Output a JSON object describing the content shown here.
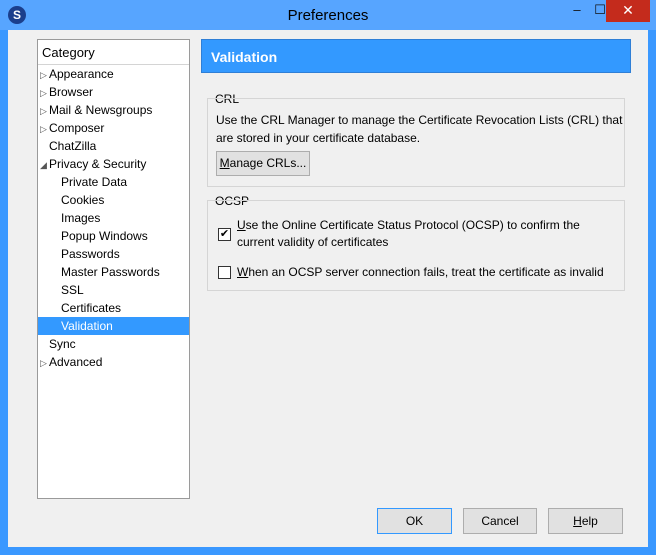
{
  "window": {
    "title": "Preferences",
    "icon": "app-logo-icon",
    "controls": {
      "minimize": "–",
      "maximize": "☐",
      "close": "✕"
    }
  },
  "category": {
    "header": "Category",
    "items": [
      {
        "label": "Appearance",
        "expander": "▷"
      },
      {
        "label": "Browser",
        "expander": "▷"
      },
      {
        "label": "Mail & Newsgroups",
        "expander": "▷"
      },
      {
        "label": "Composer",
        "expander": "▷"
      },
      {
        "label": "ChatZilla",
        "expander": ""
      },
      {
        "label": "Privacy & Security",
        "expander": "◢"
      },
      {
        "label": "Private Data"
      },
      {
        "label": "Cookies"
      },
      {
        "label": "Images"
      },
      {
        "label": "Popup Windows"
      },
      {
        "label": "Passwords"
      },
      {
        "label": "Master Passwords"
      },
      {
        "label": "SSL"
      },
      {
        "label": "Certificates"
      },
      {
        "label": "Validation",
        "selected": true
      },
      {
        "label": "Sync",
        "expander": ""
      },
      {
        "label": "Advanced",
        "expander": "▷"
      }
    ]
  },
  "panel": {
    "title": "Validation",
    "crl": {
      "label": "CRL",
      "line1": "Use the CRL Manager to manage the Certificate Revocation Lists (CRL) that",
      "line2": "are stored in your certificate database.",
      "button_prefix": "M",
      "button_rest": "anage CRLs..."
    },
    "ocsp": {
      "label": "OCSP",
      "check1": {
        "checked": true,
        "prefix": "U",
        "rest": "se the Online Certificate Status Protocol (OCSP) to confirm the",
        "line2": "current validity of certificates"
      },
      "check2": {
        "checked": false,
        "prefix": "W",
        "rest": "hen an OCSP server connection fails, treat the certificate as invalid"
      }
    }
  },
  "buttons": {
    "ok": "OK",
    "cancel": "Cancel",
    "help_prefix": "H",
    "help_rest": "elp"
  },
  "colors": {
    "selection": "#3399ff",
    "titlebar": "#57a5ff",
    "close": "#c42b1c"
  }
}
